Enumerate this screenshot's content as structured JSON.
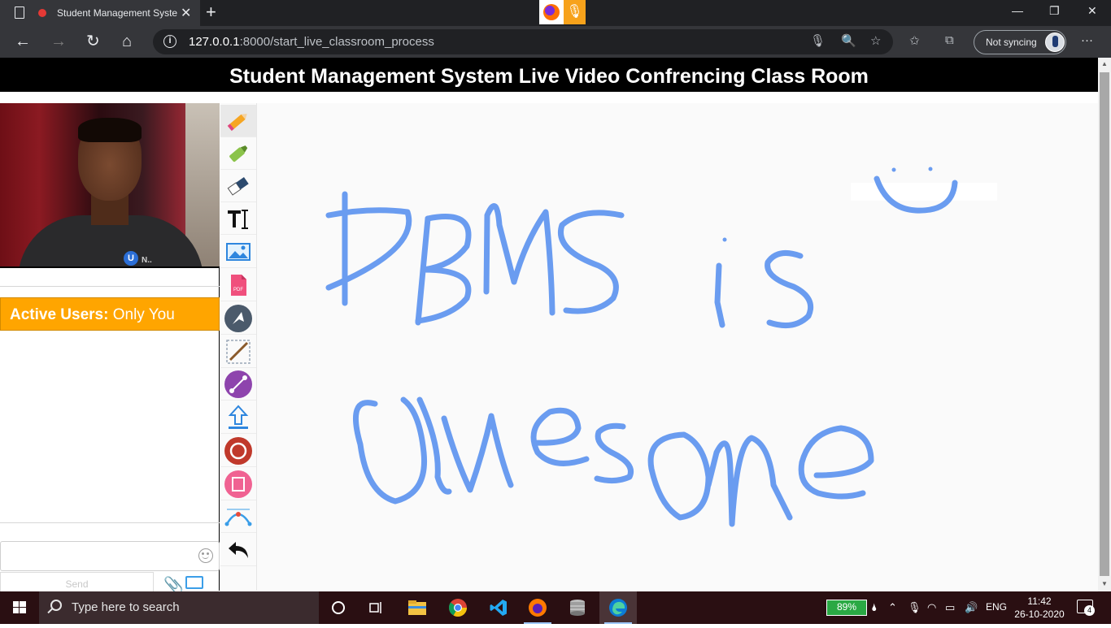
{
  "browser": {
    "tab_title": "Student Management Syste",
    "tab_close": "✕",
    "new_tab": "+",
    "url_host": "127.0.0.1",
    "url_path": ":8000/start_live_classroom_process",
    "profile_status": "Not syncing",
    "win_min": "—",
    "win_restore": "❐",
    "win_close": "✕"
  },
  "page": {
    "header_title": "Student Management System Live Video Confrencing Class Room"
  },
  "sidebar": {
    "active_users_label": "Active Users:",
    "active_users_value": "Only You",
    "video_logo_u": "U",
    "video_logo_text": "N..",
    "send_label": "Send",
    "chat_placeholder": ""
  },
  "toolbar": {
    "tools": [
      {
        "name": "pencil-tool",
        "icon": "pencil-icon",
        "selected": true
      },
      {
        "name": "marker-tool",
        "icon": "marker-icon"
      },
      {
        "name": "eraser-tool",
        "icon": "eraser-icon"
      },
      {
        "name": "text-tool",
        "icon": "text-icon"
      },
      {
        "name": "image-tool",
        "icon": "image-icon"
      },
      {
        "name": "pdf-tool",
        "icon": "pdf-icon"
      },
      {
        "name": "arrow-tool",
        "icon": "arrow-icon"
      },
      {
        "name": "line-tool",
        "icon": "line-icon"
      },
      {
        "name": "connector-tool",
        "icon": "connector-icon"
      },
      {
        "name": "upload-tool",
        "icon": "upload-icon"
      },
      {
        "name": "circle-tool",
        "icon": "circle-icon"
      },
      {
        "name": "rectangle-tool",
        "icon": "rectangle-icon"
      },
      {
        "name": "bezier-tool",
        "icon": "bezier-icon"
      },
      {
        "name": "undo-tool",
        "icon": "undo-icon"
      }
    ]
  },
  "whiteboard": {
    "stroke_color": "#6a9cf0"
  },
  "taskbar": {
    "search_placeholder": "Type here to search",
    "battery": "89%",
    "language": "ENG",
    "time": "11:42",
    "date": "26-10-2020",
    "notifications": "4"
  },
  "colors": {
    "header_bg": "#000000",
    "active_users_bg": "#ffa500",
    "taskbar_bg": "#2a0f12"
  }
}
